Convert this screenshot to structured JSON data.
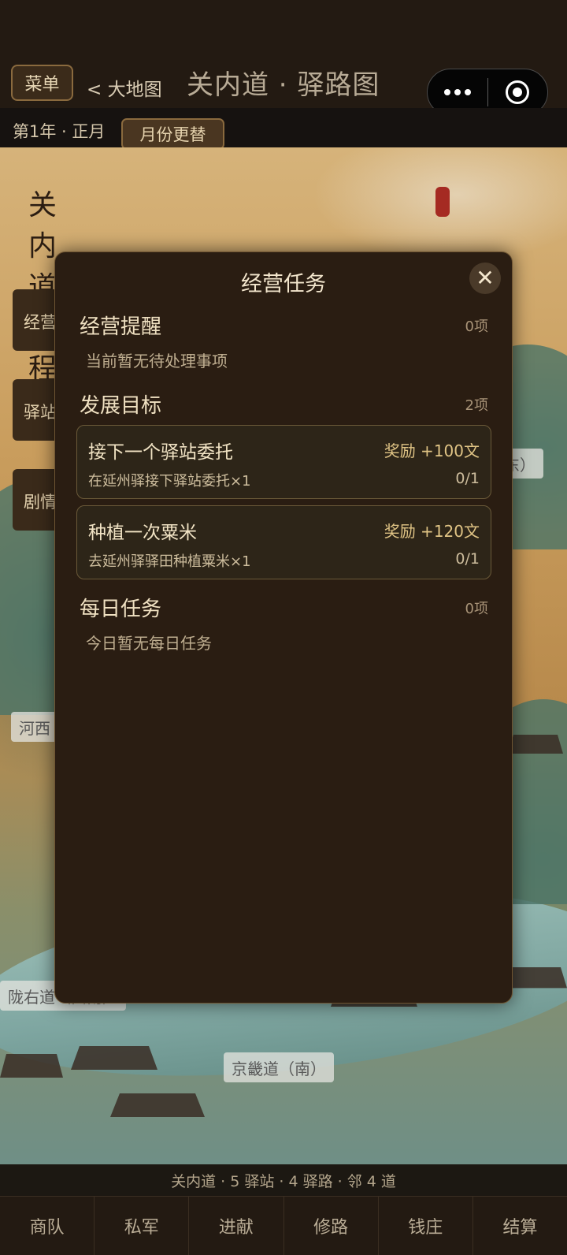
{
  "header": {
    "menu_label": "菜单",
    "back_label": "< 大地图",
    "title": "关内道 · 驿路图"
  },
  "date_bar": {
    "date": "第1年 · 正月",
    "month_button": "月份更替"
  },
  "map": {
    "vertical_title": "关内道驿程图",
    "side_tabs": [
      "经营",
      "驿站",
      "剧情"
    ],
    "region_labels": {
      "east": "东）",
      "west": "河西",
      "southwest": "陇右道（西南）",
      "south": "京畿道（南）"
    }
  },
  "modal": {
    "title": "经营任务",
    "close_icon": "close-icon",
    "reminders": {
      "title": "经营提醒",
      "count": "0项",
      "empty": "当前暂无待处理事项"
    },
    "goals": {
      "title": "发展目标",
      "count": "2项",
      "items": [
        {
          "name": "接下一个驿站委托",
          "reward": "奖励 +100文",
          "desc": "在延州驿接下驿站委托×1",
          "progress": "0/1"
        },
        {
          "name": "种植一次粟米",
          "reward": "奖励 +120文",
          "desc": "去延州驿驿田种植粟米×1",
          "progress": "0/1"
        }
      ]
    },
    "daily": {
      "title": "每日任务",
      "count": "0项",
      "empty": "今日暂无每日任务"
    }
  },
  "summary": "关内道 · 5 驿站 · 4 驿路 · 邻 4 道",
  "bottom_nav": [
    "商队",
    "私军",
    "进献",
    "修路",
    "钱庄",
    "结算"
  ]
}
